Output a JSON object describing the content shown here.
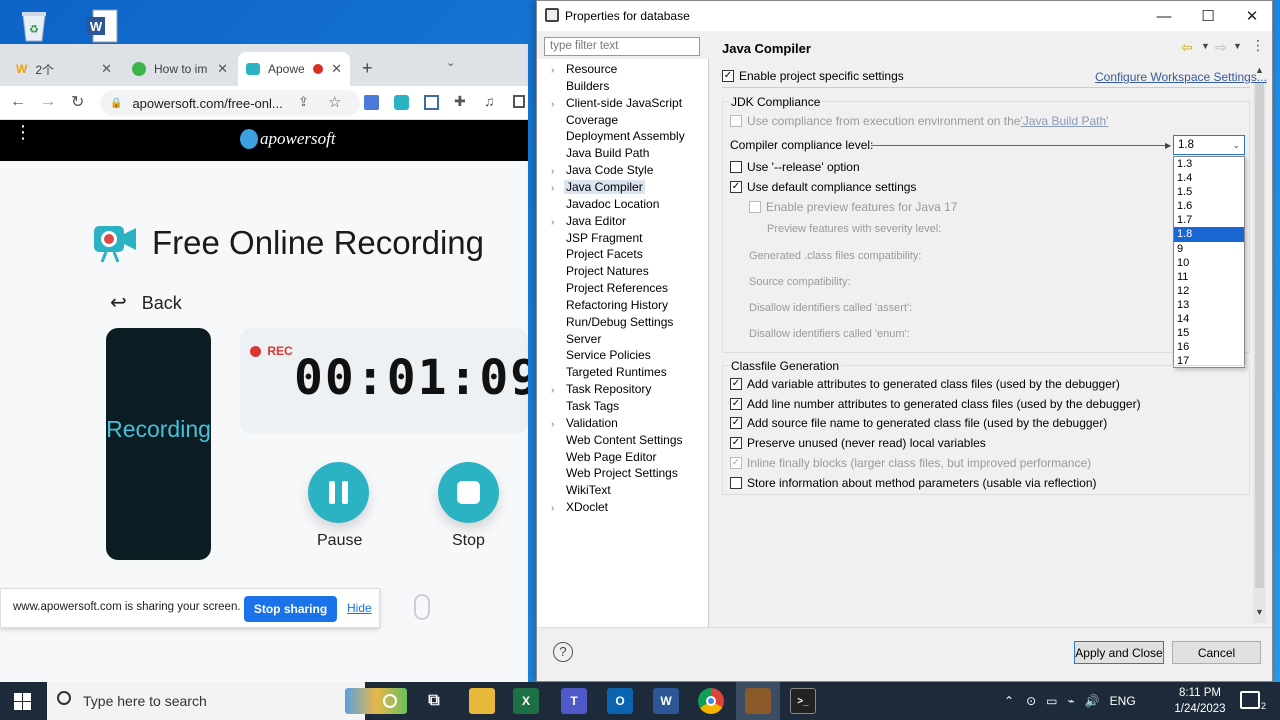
{
  "browser": {
    "tabs": [
      {
        "label": "2个"
      },
      {
        "label": "How to im"
      },
      {
        "label": "Apowe"
      }
    ],
    "url": "apowersoft.com/free-onl...",
    "site_logo": "apowersoft",
    "page_title": "Free Online Recording",
    "back_label": "Back",
    "phone_text": "Recording",
    "rec_label": "REC",
    "timer": "00:01:09",
    "pause_label": "Pause",
    "stop_label": "Stop",
    "share_message": "www.apowersoft.com is sharing your screen.",
    "stop_sharing": "Stop sharing",
    "hide": "Hide"
  },
  "dialog": {
    "title": "Properties for database",
    "filter_placeholder": "type filter text",
    "tree": [
      {
        "label": "Resource",
        "expandable": true
      },
      {
        "label": "Builders",
        "expandable": false
      },
      {
        "label": "Client-side JavaScript",
        "expandable": true
      },
      {
        "label": "Coverage",
        "expandable": false
      },
      {
        "label": "Deployment Assembly",
        "expandable": false
      },
      {
        "label": "Java Build Path",
        "expandable": false
      },
      {
        "label": "Java Code Style",
        "expandable": true
      },
      {
        "label": "Java Compiler",
        "expandable": true,
        "selected": true
      },
      {
        "label": "Javadoc Location",
        "expandable": false
      },
      {
        "label": "Java Editor",
        "expandable": true
      },
      {
        "label": "JSP Fragment",
        "expandable": false
      },
      {
        "label": "Project Facets",
        "expandable": false
      },
      {
        "label": "Project Natures",
        "expandable": false
      },
      {
        "label": "Project References",
        "expandable": false
      },
      {
        "label": "Refactoring History",
        "expandable": false
      },
      {
        "label": "Run/Debug Settings",
        "expandable": false
      },
      {
        "label": "Server",
        "expandable": false
      },
      {
        "label": "Service Policies",
        "expandable": false
      },
      {
        "label": "Targeted Runtimes",
        "expandable": false
      },
      {
        "label": "Task Repository",
        "expandable": true
      },
      {
        "label": "Task Tags",
        "expandable": false
      },
      {
        "label": "Validation",
        "expandable": true
      },
      {
        "label": "Web Content Settings",
        "expandable": false
      },
      {
        "label": "Web Page Editor",
        "expandable": false
      },
      {
        "label": "Web Project Settings",
        "expandable": false
      },
      {
        "label": "WikiText",
        "expandable": false
      },
      {
        "label": "XDoclet",
        "expandable": true
      }
    ],
    "page_heading": "Java Compiler",
    "enable_project_settings": "Enable project specific settings",
    "configure_link": "Configure Workspace Settings...",
    "jdk_group": "JDK Compliance",
    "use_compliance_env": "Use compliance from execution environment on the ",
    "java_build_path_link": "'Java Build Path'",
    "compliance_level_label": "Compiler compliance level:",
    "compliance_value": "1.8",
    "compliance_options": [
      "1.3",
      "1.4",
      "1.5",
      "1.6",
      "1.7",
      "1.8",
      "9",
      "10",
      "11",
      "12",
      "13",
      "14",
      "15",
      "16",
      "17"
    ],
    "use_release": "Use '--release' option",
    "use_default_compliance": "Use default compliance settings",
    "enable_preview": "Enable preview features for Java 17",
    "preview_severity": "Preview features with severity level:",
    "generated_compat": "Generated .class files compatibility:",
    "source_compat": "Source compatibility:",
    "disallow_assert": "Disallow identifiers called 'assert':",
    "disallow_enum": "Disallow identifiers called 'enum':",
    "classfile_group": "Classfile Generation",
    "classfile_options": [
      {
        "label": "Add variable attributes to generated class files (used by the debugger)",
        "checked": true,
        "disabled": false
      },
      {
        "label": "Add line number attributes to generated class files (used by the debugger)",
        "checked": true,
        "disabled": false
      },
      {
        "label": "Add source file name to generated class file (used by the debugger)",
        "checked": true,
        "disabled": false
      },
      {
        "label": "Preserve unused (never read) local variables",
        "checked": true,
        "disabled": false
      },
      {
        "label": "Inline finally blocks (larger class files, but improved performance)",
        "checked": true,
        "disabled": true
      },
      {
        "label": "Store information about method parameters (usable via reflection)",
        "checked": false,
        "disabled": false
      }
    ],
    "apply_close": "Apply and Close",
    "cancel": "Cancel"
  },
  "taskbar": {
    "search_placeholder": "Type here to search",
    "language": "ENG",
    "time": "8:11 PM",
    "date": "1/24/2023",
    "notification_count": "2"
  }
}
